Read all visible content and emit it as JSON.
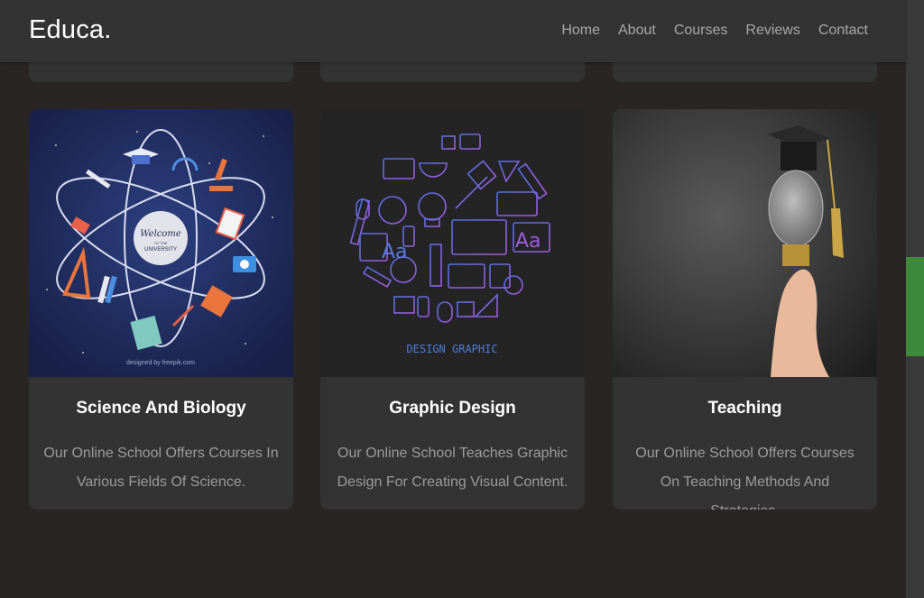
{
  "header": {
    "logo": "Educa.",
    "nav": [
      "Home",
      "About",
      "Courses",
      "Reviews",
      "Contact"
    ]
  },
  "cards": [
    {
      "title": "Science And Biology",
      "description": "Our Online School Offers Courses In Various Fields Of Science.",
      "image": {
        "banner_line1": "Welcome",
        "banner_line2": "TO THE",
        "banner_line3": "UNIVERSITY",
        "credit": "designed by freepik.com"
      }
    },
    {
      "title": "Graphic Design",
      "description": "Our Online School Teaches Graphic Design For Creating Visual Content.",
      "image": {
        "caption": "DESIGN GRAPHIC"
      }
    },
    {
      "title": "Teaching",
      "description": "Our Online School Offers Courses On Teaching Methods And Strategies.",
      "image": {}
    }
  ],
  "colors": {
    "page_bg": "#2a2525",
    "card_bg": "#333333",
    "scroll_thumb": "#3f8a3a"
  }
}
